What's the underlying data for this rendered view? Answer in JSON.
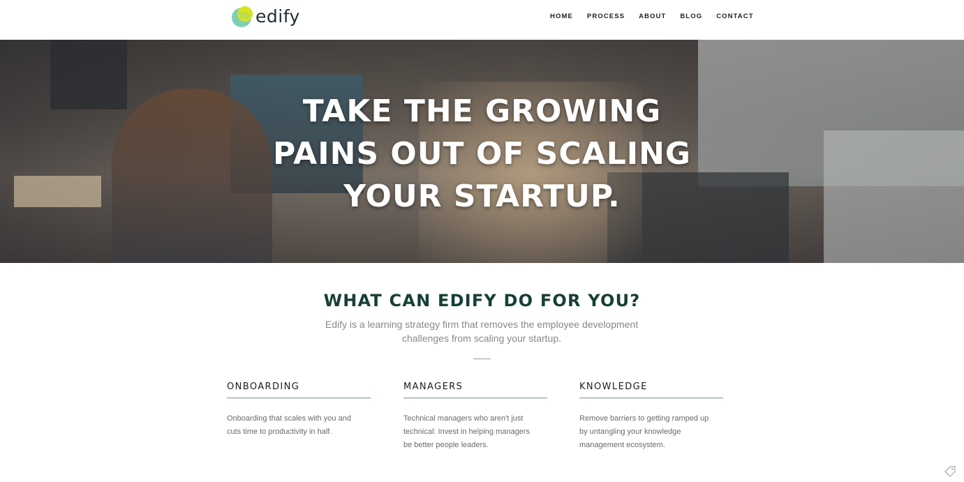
{
  "brand": {
    "name": "edify",
    "accent": "#173f35",
    "logo_colors": [
      "#d8e51a",
      "#7ecfb3"
    ]
  },
  "nav": {
    "items": [
      {
        "label": "HOME"
      },
      {
        "label": "PROCESS"
      },
      {
        "label": "ABOUT"
      },
      {
        "label": "BLOG"
      },
      {
        "label": "CONTACT"
      }
    ]
  },
  "hero": {
    "lines": [
      "TAKE THE GROWING",
      "PAINS OUT OF SCALING",
      "YOUR STARTUP."
    ],
    "background": "office-photo"
  },
  "intro": {
    "title": "WHAT CAN EDIFY DO FOR YOU?",
    "subtitle": "Edify is a learning strategy firm that removes the employee development challenges from scaling your startup."
  },
  "features": [
    {
      "title": "ONBOARDING",
      "text": "Onboarding that scales with you and cuts time to productivity in half."
    },
    {
      "title": "MANAGERS",
      "text": "Technical managers who aren't just technical: Invest in helping managers be better people leaders."
    },
    {
      "title": "KNOWLEDGE",
      "text": "Remove barriers to getting ramped up by untangling your knowledge management ecosystem."
    }
  ],
  "icons": {
    "corner": "tag-icon"
  }
}
